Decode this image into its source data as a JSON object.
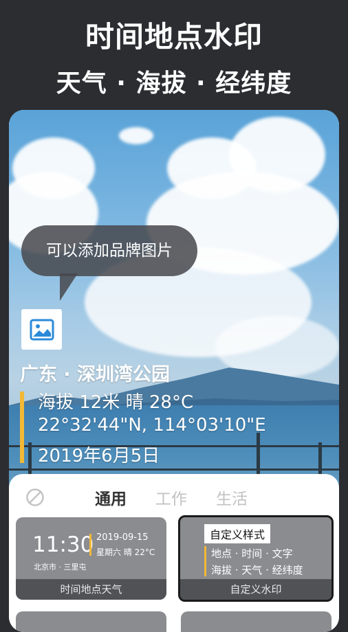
{
  "header": {
    "title": "时间地点水印",
    "subtitle": "天气 · 海拔 · 经纬度"
  },
  "photo": {
    "bubble_text": "可以添加品牌图片",
    "logo_icon": "image-icon"
  },
  "watermark": {
    "location": "广东 · 深圳湾公园",
    "altitude_weather": "海拔 12米  晴 28°C",
    "coordinates": "22°32'44\"N, 114°03'10\"E",
    "date": "2019年6月5日",
    "accent_color": "#f2b935"
  },
  "tabs": {
    "disable_icon": "no-icon",
    "items": [
      {
        "label": "通用"
      },
      {
        "label": "工作"
      },
      {
        "label": "生活"
      }
    ]
  },
  "templates": [
    {
      "caption": "时间地点天气",
      "time": "11:30",
      "date": "2019-09-15",
      "weekday_weather": "星期六 晴 22°C",
      "place": "北京市 · 三里屯"
    },
    {
      "caption": "自定义水印",
      "title": "自定义样式",
      "line1": "地点 · 时间 · 文字",
      "line2": "海拔 · 天气 · 经纬度"
    }
  ]
}
